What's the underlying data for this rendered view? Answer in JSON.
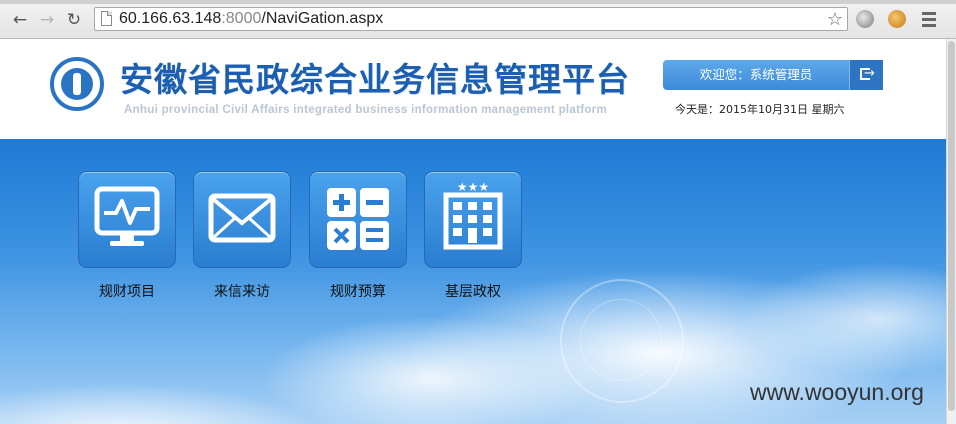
{
  "browser": {
    "url_host": "60.166.63.148",
    "url_port": ":8000",
    "url_path": "/NaviGation.aspx",
    "back_icon": "arrow-left-icon",
    "forward_icon": "arrow-right-icon",
    "reload_icon": "reload-icon",
    "star_icon": "star-icon"
  },
  "header": {
    "title": "安徽省民政综合业务信息管理平台",
    "subtitle": "Anhui provincial Civil Affairs integrated business information management platform",
    "welcome": "欢迎您：系统管理员",
    "date": "今天是：2015年10月31日  星期六",
    "brand_color": "#1c5fb0",
    "welcome_bg": "#4a9be2"
  },
  "tiles": [
    {
      "label": "规财项目",
      "icon": "monitor-pulse-icon"
    },
    {
      "label": "来信来访",
      "icon": "envelope-icon"
    },
    {
      "label": "规财预算",
      "icon": "calculator-icon"
    },
    {
      "label": "基层政权",
      "icon": "building-icon"
    }
  ],
  "watermark": "www.wooyun.org"
}
